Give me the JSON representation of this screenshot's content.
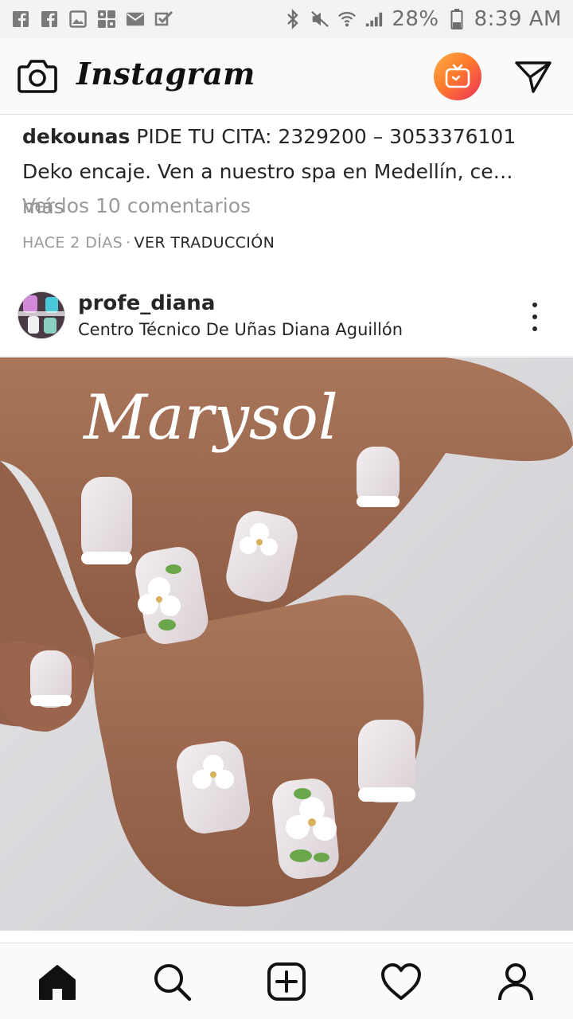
{
  "status_bar": {
    "battery": "28%",
    "time": "8:39 AM"
  },
  "app_bar": {
    "brand": "Instagram"
  },
  "caption": {
    "username": "dekounas",
    "line1": "PIDE TU CITA: 2329200 – 3053376101",
    "line2": "Deko encaje. Ven a nuestro spa en Medellín, ce…",
    "more": "más"
  },
  "comments_link": "Ver los 10 comentarios",
  "meta": {
    "time": "HACE 2 DÍAS",
    "separator": "·",
    "translate": "VER TRADUCCIÓN"
  },
  "post": {
    "username": "profe_diana",
    "location": "Centro Técnico De Uñas Diana Aguillón",
    "watermark": "Marysol"
  },
  "colors": {
    "igtv_gradient_start": "#fcaf45",
    "igtv_gradient_end": "#f0305a",
    "text_primary": "#262626",
    "text_secondary": "#8e8e8e"
  },
  "icons": {
    "status_left": [
      "facebook-icon",
      "facebook-icon",
      "gallery-icon",
      "grid-app-icon",
      "mail-icon",
      "check-app-icon"
    ],
    "status_right": [
      "bluetooth-icon",
      "mute-icon",
      "wifi-icon",
      "signal-icon",
      "battery-icon"
    ],
    "bottom_nav": [
      "home-icon",
      "search-icon",
      "add-post-icon",
      "heart-icon",
      "profile-icon"
    ]
  }
}
